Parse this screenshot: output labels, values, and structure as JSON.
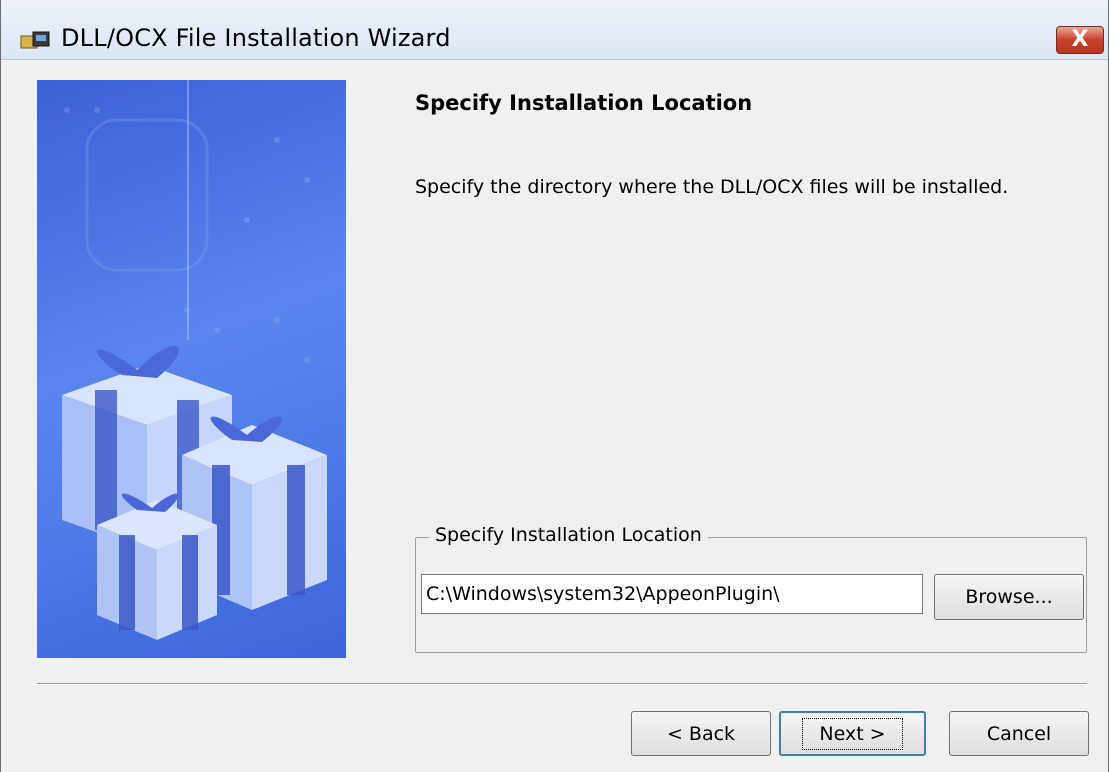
{
  "window": {
    "title": "DLL/OCX File Installation Wizard",
    "close_label": "X"
  },
  "page": {
    "heading": "Specify Installation Location",
    "description": "Specify the directory where the DLL/OCX files will be installed."
  },
  "location_group": {
    "legend": "Specify Installation Location",
    "path_value": "C:\\Windows\\system32\\AppeonPlugin\\",
    "browse_label": "Browse..."
  },
  "footer": {
    "back_label": "< Back",
    "next_label": "Next >",
    "cancel_label": "Cancel"
  },
  "icons": {
    "app": "setup-gift-icon",
    "close": "close-icon",
    "side": "gift-boxes-illustration"
  },
  "colors": {
    "side_image": "#4c7ae6",
    "close_button": "#c9412b",
    "default_button_border": "#3c7fb1"
  }
}
